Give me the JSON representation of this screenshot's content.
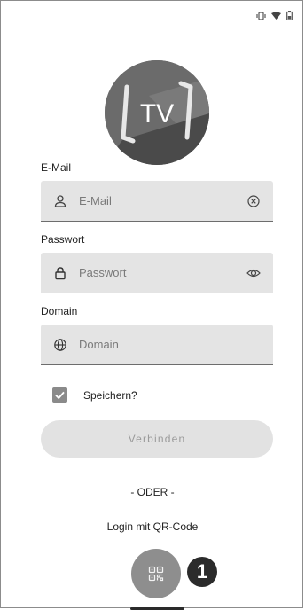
{
  "status_bar": {
    "icons": [
      "vibrate-icon",
      "wifi-icon",
      "battery-icon"
    ]
  },
  "logo": {
    "text": "TV"
  },
  "email": {
    "label": "E-Mail",
    "placeholder": "E-Mail",
    "lead_icon": "person-icon",
    "trail_icon": "clear-icon"
  },
  "password": {
    "label": "Passwort",
    "placeholder": "Passwort",
    "lead_icon": "lock-icon",
    "trail_icon": "eye-icon"
  },
  "domain": {
    "label": "Domain",
    "placeholder": "Domain",
    "lead_icon": "globe-icon"
  },
  "remember": {
    "label": "Speichern?",
    "checked": true
  },
  "connect_button": {
    "label": "Verbinden"
  },
  "divider_text": "- ODER -",
  "qr_login": {
    "label": "Login mit QR-Code",
    "icon": "qr-code-icon"
  },
  "annotation_badge": "1",
  "colors": {
    "field_bg": "#e4e4e4",
    "fab_bg": "#8e8e8e",
    "badge_bg": "#2b2b2b"
  }
}
